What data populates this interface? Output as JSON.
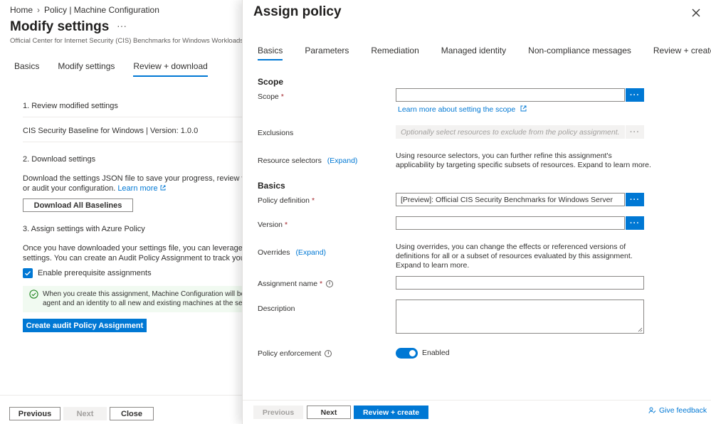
{
  "left": {
    "breadcrumb": [
      "Home",
      "Policy | Machine Configuration"
    ],
    "title": "Modify settings",
    "more": "···",
    "subtitle": "Official Center for Internet Security (CIS) Benchmarks for Windows Workloads",
    "tabs": [
      "Basics",
      "Modify settings",
      "Review + download"
    ],
    "active_tab": "Review + download",
    "s1_title": "1. Review modified settings",
    "baseline": "CIS Security Baseline for Windows | Version: 1.0.0",
    "s2_title": "2. Download settings",
    "s2_text": "Download the settings JSON file to save your progress, review with yo",
    "s2_text2": "or audit your configuration.",
    "learn_more": "Learn more",
    "download_btn": "Download All Baselines",
    "s3_title": "3. Assign settings with Azure Policy",
    "s3_text1": "Once you have downloaded your settings file, you can leverage Azure",
    "s3_text2": "settings. You can create an Audit Policy Assignment to track your mac",
    "checkbox_label": "Enable prerequisite assignments",
    "info_line1": "When you create this assignment, Machine Configuration will be sea",
    "info_line2": "agent and an identity to all new and existing machines at the selecte",
    "create_btn": "Create audit Policy Assignment",
    "footer": {
      "previous": "Previous",
      "next": "Next",
      "close": "Close"
    }
  },
  "panel": {
    "title": "Assign policy",
    "tabs": [
      "Basics",
      "Parameters",
      "Remediation",
      "Managed identity",
      "Non-compliance messages",
      "Review + create"
    ],
    "active_tab": "Basics",
    "scope_head": "Scope",
    "scope_label": "Scope",
    "scope_value": "",
    "scope_link": "Learn more about setting the scope",
    "exclusions_label": "Exclusions",
    "exclusions_placeholder": "Optionally select resources to exclude from the policy assignment.",
    "resource_selectors_label": "Resource selectors",
    "expand": "(Expand)",
    "resource_selectors_desc": "Using resource selectors, you can further refine this assignment's applicability by targeting specific subsets of resources. Expand to learn more.",
    "basics_head": "Basics",
    "policy_def_label": "Policy definition",
    "policy_def_value": "[Preview]: Official CIS Security Benchmarks for Windows Server",
    "version_label": "Version",
    "version_value": "",
    "overrides_label": "Overrides",
    "overrides_desc": "Using overrides, you can change the effects or referenced versions of definitions for all or a subset of resources evaluated by this assignment. Expand to learn more.",
    "assignment_name_label": "Assignment name",
    "assignment_name_value": "",
    "description_label": "Description",
    "enforcement_label": "Policy enforcement",
    "enforcement_value": "Enabled",
    "required_mark": "*",
    "info_mark": "i",
    "dots": "···",
    "footer": {
      "previous": "Previous",
      "next": "Next",
      "review": "Review + create",
      "feedback": "Give feedback"
    }
  },
  "colors": {
    "accent": "#0078d4",
    "success_bg": "#f1faf1",
    "required": "#a4262c"
  }
}
